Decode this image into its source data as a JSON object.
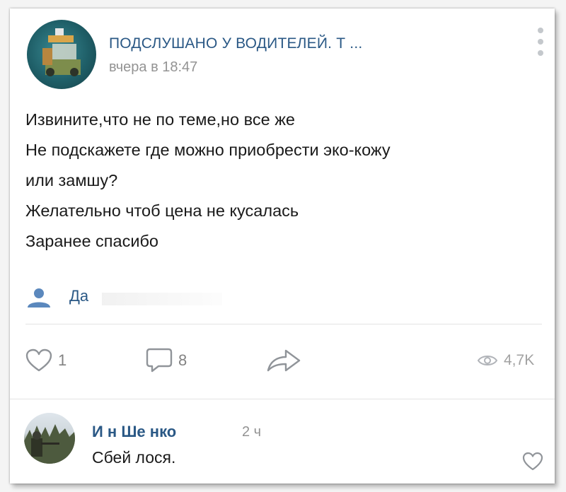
{
  "post": {
    "group_title": "ПОДСЛУШАНО У ВОДИТЕЛЕЙ. Т      ...",
    "time": "вчера в 18:47",
    "lines": [
      "Извините,что не по теме,но все же",
      "Не подскажете где можно приобрести эко-кожу",
      "или замшу?",
      "Желательно чтоб цена не кусалась",
      "Заранее спасибо"
    ],
    "author_label": "Да",
    "likes": "1",
    "comments": "8",
    "views": "4,7K"
  },
  "comment": {
    "author": "И   н Ше    нко",
    "time": "2 ч",
    "text": "Сбей лося."
  },
  "colors": {
    "link_blue": "#2a5885",
    "icon_blue": "#5b88bd",
    "icon_gray": "#909499"
  },
  "icons": [
    "more-vertical-icon",
    "person-icon",
    "heart-icon",
    "comment-icon",
    "share-icon",
    "eye-icon"
  ]
}
